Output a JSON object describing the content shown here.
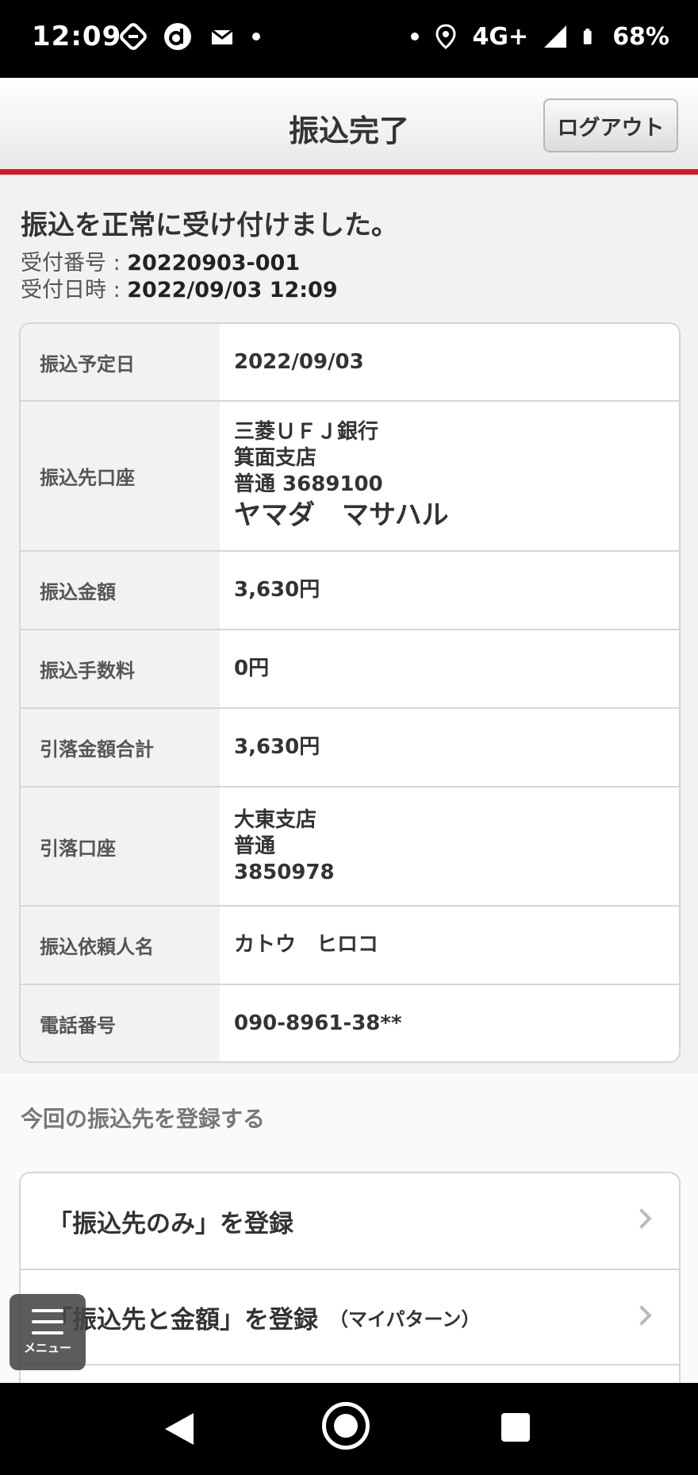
{
  "status_bar": {
    "time": "12:09",
    "network": "4G+",
    "battery": "68%",
    "left_icons": [
      "sync-icon",
      "d-app-icon",
      "mail-icon"
    ],
    "right_icons": [
      "location-icon",
      "signal-icon",
      "battery-icon"
    ]
  },
  "header": {
    "title": "振込完了",
    "logout_label": "ログアウト"
  },
  "result": {
    "message": "振込を正常に受け付けました。",
    "receipt_number_label": "受付番号 : ",
    "receipt_number": "20220903-001",
    "receipt_datetime_label": "受付日時 : ",
    "receipt_datetime": "2022/09/03 12:09"
  },
  "details": {
    "scheduled_date": {
      "label": "振込予定日",
      "value": "2022/09/03"
    },
    "destination": {
      "label": "振込先口座",
      "bank": "三菱ＵＦＪ銀行",
      "branch": "箕面支店",
      "account": "普通 3689100",
      "holder": "ヤマダ　マサハル"
    },
    "amount": {
      "label": "振込金額",
      "value": "3,630円"
    },
    "fee": {
      "label": "振込手数料",
      "value": "0円"
    },
    "total": {
      "label": "引落金額合計",
      "value": "3,630円"
    },
    "debit_account": {
      "label": "引落口座",
      "branch": "大東支店",
      "type": "普通",
      "number": "3850978"
    },
    "requester": {
      "label": "振込依頼人名",
      "value": "カトウ　ヒロコ"
    },
    "phone": {
      "label": "電話番号",
      "value": "090-8961-38**"
    }
  },
  "register": {
    "title": "今回の振込先を登録する",
    "items": [
      {
        "label": "「振込先のみ」を登録",
        "sub": ""
      },
      {
        "label": "「振込先と金額」を登録",
        "sub": "（マイパターン）"
      }
    ]
  },
  "menu": {
    "label": "メニュー"
  },
  "colors": {
    "accent_red": "#d71920",
    "background": "#f2f2f2"
  }
}
